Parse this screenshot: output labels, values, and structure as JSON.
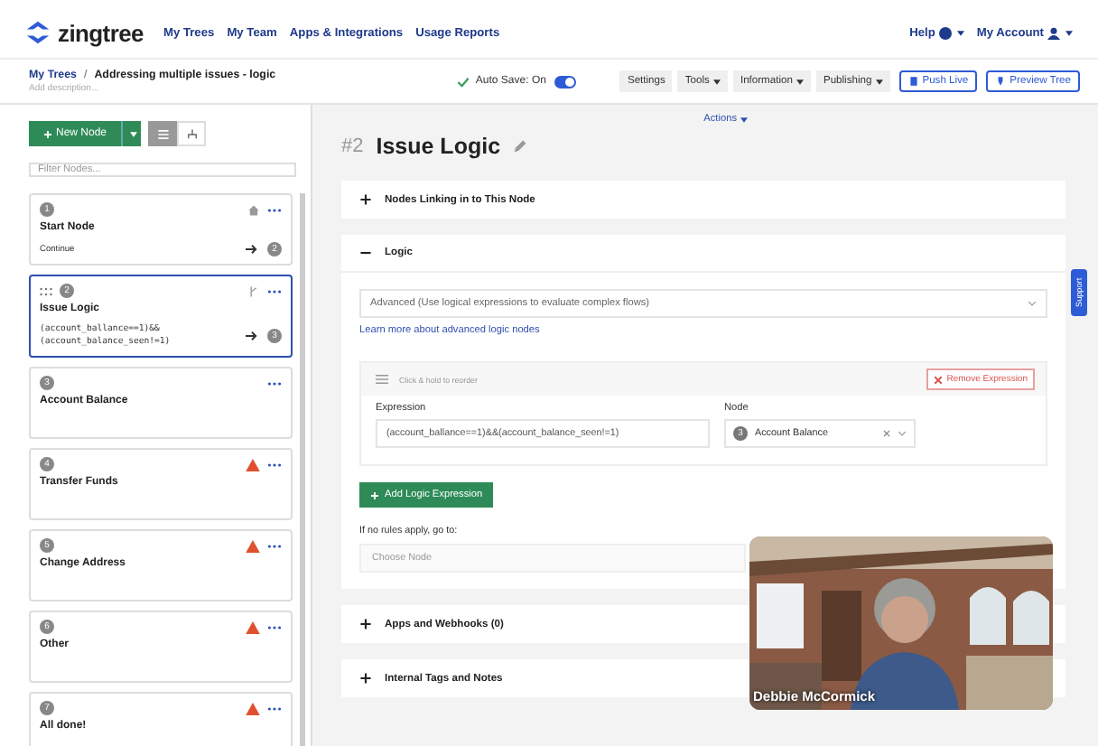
{
  "nav": {
    "brand": "zingtree",
    "links": [
      "My Trees",
      "My Team",
      "Apps & Integrations",
      "Usage Reports"
    ],
    "help": "Help",
    "account": "My Account"
  },
  "breadcrumb": {
    "root": "My Trees",
    "separator": "/",
    "title": "Addressing multiple issues - logic",
    "description_placeholder": "Add description..."
  },
  "autosave": {
    "label": "Auto Save: On",
    "on": true
  },
  "toolbar": [
    {
      "label": "Settings",
      "kind": "plain"
    },
    {
      "label": "Tools",
      "kind": "menu"
    },
    {
      "label": "Information",
      "kind": "menu"
    },
    {
      "label": "Publishing",
      "kind": "menu"
    },
    {
      "label": "Push Live",
      "kind": "file"
    },
    {
      "label": "Preview Tree",
      "kind": "preview"
    }
  ],
  "sidebar": {
    "new_node": "New Node",
    "view_modes": [
      {
        "kind": "list",
        "selected": true
      },
      {
        "kind": "tree",
        "selected": false
      }
    ],
    "filter_placeholder": "Filter Nodes...",
    "nodes": [
      {
        "number": "1",
        "title": "Start Node",
        "kind": "start",
        "selected": false,
        "link": "Continue",
        "target": "2"
      },
      {
        "number": "2",
        "title": "Issue Logic",
        "kind": "logic",
        "selected": true,
        "expression_lines": [
          "(account_ballance==1)&&",
          "(account_balance_seen!=1)"
        ],
        "target": "3"
      },
      {
        "number": "3",
        "title": "Account Balance",
        "kind": "plain",
        "selected": false
      },
      {
        "number": "4",
        "title": "Transfer Funds",
        "kind": "warning",
        "selected": false
      },
      {
        "number": "5",
        "title": "Change Address",
        "kind": "warning",
        "selected": false
      },
      {
        "number": "6",
        "title": "Other",
        "kind": "warning",
        "selected": false
      },
      {
        "number": "7",
        "title": "All done!",
        "kind": "warning",
        "selected": false
      }
    ]
  },
  "main": {
    "actions": "Actions",
    "node_id": "#2",
    "node_title": "Issue Logic",
    "sections": [
      {
        "title": "Nodes Linking in to This Node",
        "expanded": false
      },
      {
        "title": "Logic",
        "expanded": true
      },
      {
        "title": "Apps and Webhooks (0)",
        "expanded": false
      },
      {
        "title": "Internal Tags and Notes",
        "expanded": false
      }
    ],
    "logic": {
      "mode": "Advanced (Use logical expressions to evaluate complex flows)",
      "learn_more": "Learn more about advanced logic nodes",
      "reorder_hint": "Click & hold to reorder",
      "remove_button": "Remove Expression",
      "expression_label": "Expression",
      "expression_value": "(account_ballance==1)&&(account_balance_seen!=1)",
      "node_label": "Node",
      "node_number": "3",
      "node_value": "Account Balance",
      "add_button": "Add Logic Expression",
      "fallback_label": "If no rules apply, go to:",
      "fallback_placeholder": "Choose Node"
    }
  },
  "support_tab": "Support",
  "video": {
    "kind": "picture",
    "caption": "Debbie McCormick"
  }
}
